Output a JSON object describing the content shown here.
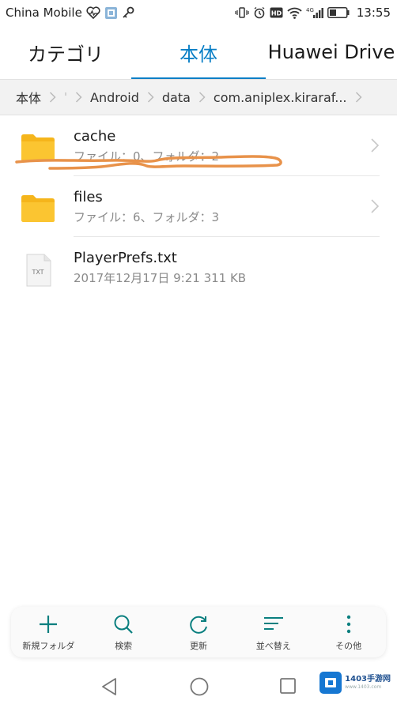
{
  "status_bar": {
    "carrier": "China Mobile",
    "network": "4G",
    "time": "13:55",
    "icons": [
      "heart-monitor-icon",
      "app-notification-icon",
      "key-icon",
      "vibrate-icon",
      "alarm-icon",
      "hd-icon",
      "wifi-icon",
      "signal-icon",
      "battery-icon"
    ]
  },
  "tabs": [
    {
      "label": "カテゴリ",
      "active": false
    },
    {
      "label": "本体",
      "active": true
    },
    {
      "label": "Huawei Drive",
      "active": false
    }
  ],
  "breadcrumb": {
    "items": [
      "本体",
      "Android",
      "data",
      "com.aniplex.kiraraf..."
    ]
  },
  "files": [
    {
      "name": "cache",
      "meta": "ファイル：0、フォルダ：2",
      "type": "folder",
      "icon": "folder-icon"
    },
    {
      "name": "files",
      "meta": "ファイル：6、フォルダ：3",
      "type": "folder",
      "icon": "folder-icon"
    },
    {
      "name": "PlayerPrefs.txt",
      "meta": "2017年12月17日 9:21 311 KB",
      "type": "txt",
      "icon": "txt-file-icon",
      "icon_text": "TXT"
    }
  ],
  "toolbar": {
    "new_folder": "新規フォルダ",
    "search": "検索",
    "refresh": "更新",
    "sort": "並べ替え",
    "more": "その他"
  },
  "watermark": {
    "text": "1403手游网",
    "sub": "www.1403.com"
  },
  "colors": {
    "accent": "#0a7fc6",
    "folder": "#fbbf24",
    "scribble": "#e8924a",
    "toolbar_icon": "#0a7f7f"
  }
}
